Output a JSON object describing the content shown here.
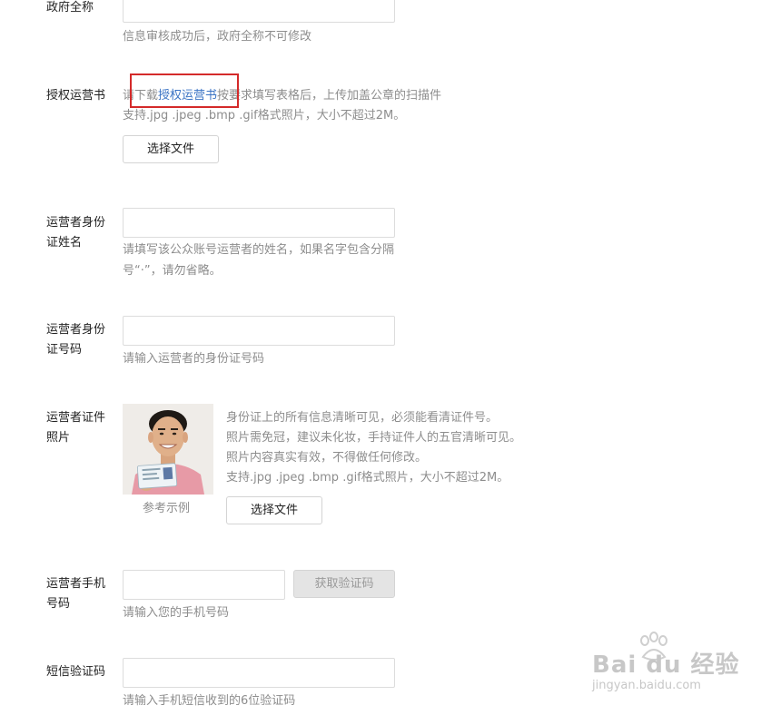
{
  "form": {
    "gov_name": {
      "label": "政府全称",
      "hint": "信息审核成功后，政府全称不可修改"
    },
    "auth_letter": {
      "label": "授权运营书",
      "hint_prefix": "请下载",
      "hint_link": "授权运营书",
      "hint_suffix": "按要求填写表格后，上传加盖公章的扫描件",
      "format_hint": "支持.jpg .jpeg .bmp .gif格式照片，大小不超过2M。",
      "button": "选择文件"
    },
    "operator_name": {
      "label_line1": "运营者身份",
      "label_line2": "证姓名",
      "hint_line1": "请填写该公众账号运营者的姓名，如果名字包含分隔",
      "hint_line2": "号“·”，请勿省略。"
    },
    "operator_id": {
      "label_line1": "运营者身份",
      "label_line2": "证号码",
      "hint": "请输入运营者的身份证号码"
    },
    "operator_photo": {
      "label_line1": "运营者证件",
      "label_line2": "照片",
      "example_caption": "参考示例",
      "requirements": [
        "身份证上的所有信息清晰可见，必须能看清证件号。",
        "照片需免冠，建议未化妆，手持证件人的五官清晰可见。",
        "照片内容真实有效，不得做任何修改。",
        "支持.jpg .jpeg .bmp .gif格式照片，大小不超过2M。"
      ],
      "button": "选择文件"
    },
    "operator_phone": {
      "label_line1": "运营者手机",
      "label_line2": "号码",
      "get_code_button": "获取验证码",
      "hint": "请输入您的手机号码"
    },
    "sms_code": {
      "label": "短信验证码",
      "hint": "请输入手机短信收到的6位验证码"
    }
  },
  "watermark": {
    "brand": "Bai du 经验",
    "url": "jingyan.baidu.com"
  },
  "colors": {
    "link": "#3a73c4",
    "highlight_box": "#d42a2a",
    "hint_text": "#8d8d8d",
    "input_border": "#dcdcdc",
    "disabled_button_bg": "#e4e4e4"
  }
}
